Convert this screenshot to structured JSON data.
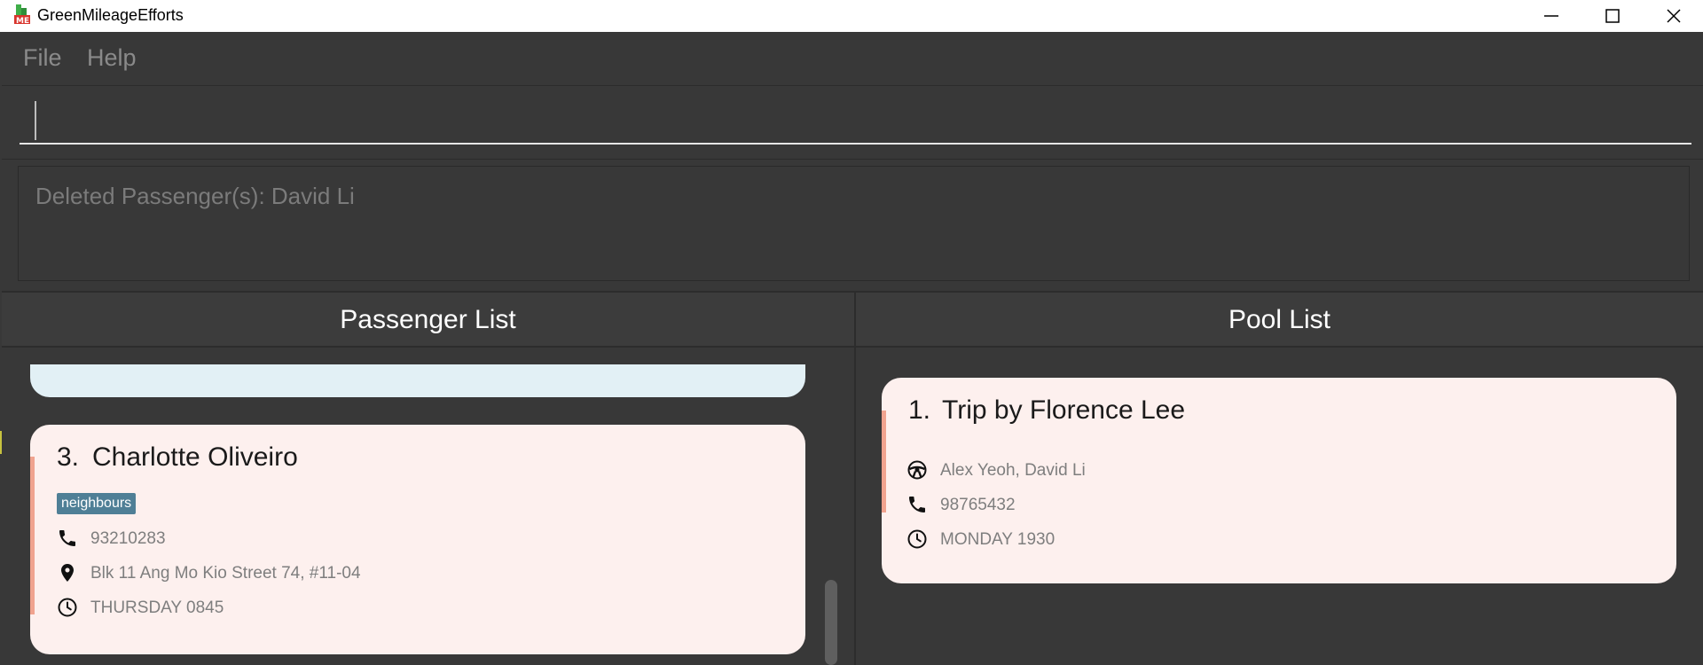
{
  "window": {
    "title": "GreenMileageEfforts",
    "controls": [
      "minimize-icon",
      "maximize-icon",
      "close-icon"
    ]
  },
  "menu": {
    "file": "File",
    "help": "Help"
  },
  "command": {
    "value": "",
    "placeholder": ""
  },
  "result": {
    "text": "Deleted Passenger(s): David Li"
  },
  "passenger_panel": {
    "title": "Passenger List",
    "cards": [
      {
        "index": "3.",
        "name": "Charlotte Oliveiro",
        "tags": [
          "neighbours"
        ],
        "phone": "93210283",
        "address": "Blk 11 Ang Mo Kio Street 74, #11-04",
        "day_time": "THURSDAY 0845"
      }
    ]
  },
  "pool_panel": {
    "title": "Pool List",
    "cards": [
      {
        "index": "1.",
        "title": "Trip by Florence Lee",
        "passengers": "Alex Yeoh, David Li",
        "phone": "98765432",
        "day_time": "MONDAY 1930"
      }
    ]
  },
  "colors": {
    "background": "#383838",
    "card_pink": "#fdf0ee",
    "card_blue": "#e2f0f5",
    "accent": "#f0a38f",
    "tag": "#4f7f96"
  }
}
